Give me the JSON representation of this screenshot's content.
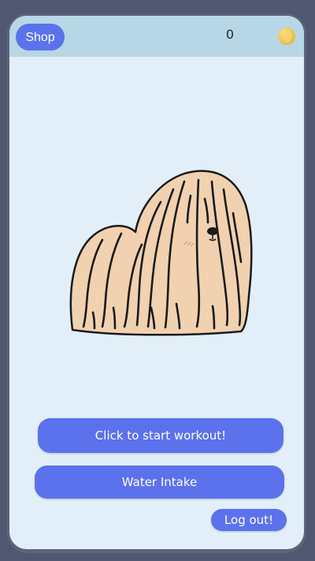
{
  "header": {
    "shop_label": "Shop",
    "coin_count": "0",
    "coin_icon": "coin-icon"
  },
  "pet": {
    "image": "shaggy-dog-illustration"
  },
  "actions": {
    "workout_label": "Click to start workout!",
    "water_label": "Water Intake",
    "logout_label": "Log out!"
  },
  "colors": {
    "accent": "#5b72ec",
    "header_bg": "#b7d7e6",
    "screen_bg": "#e3eff8",
    "coin": "#f0c94a"
  }
}
